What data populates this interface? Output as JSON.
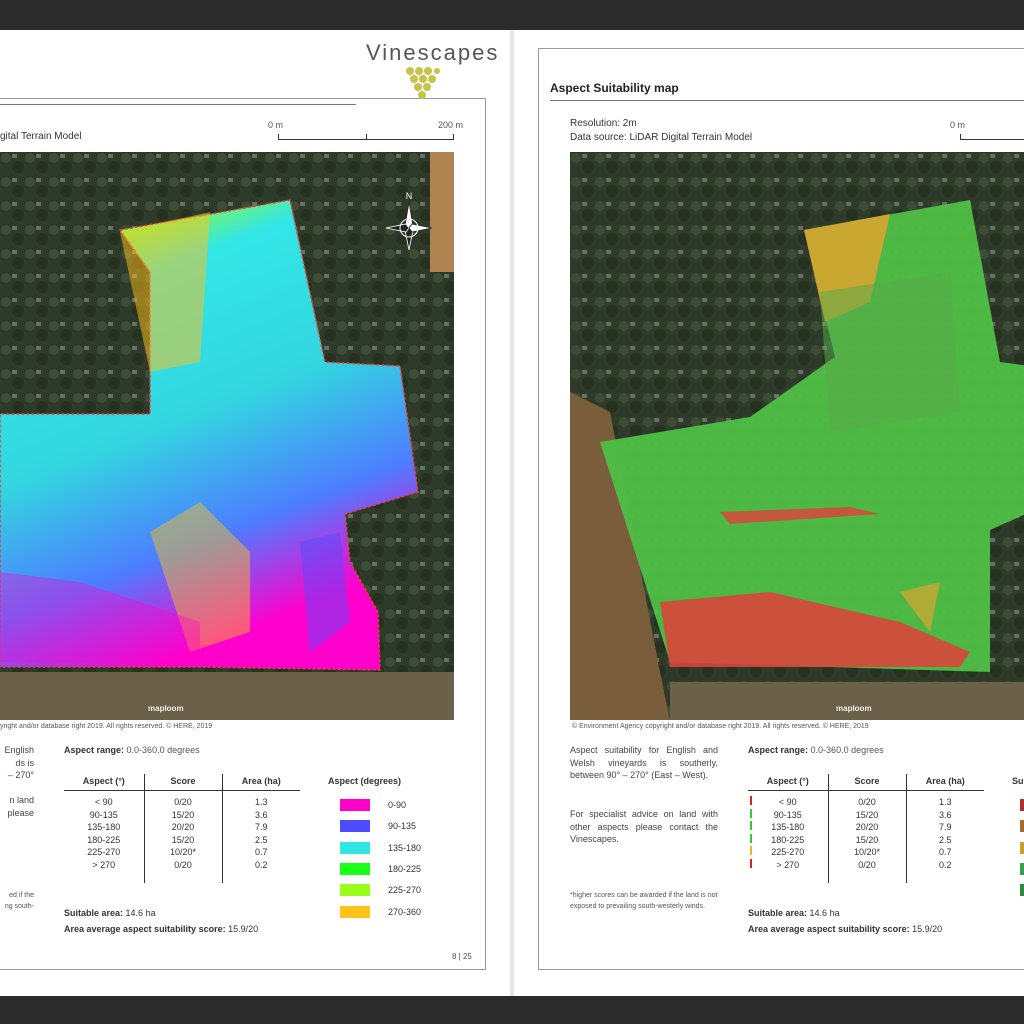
{
  "left_page": {
    "logo": "Vinescapes",
    "data_source_partial": "gital Terrain Model",
    "scale": {
      "start": "0 m",
      "end": "200 m"
    },
    "north_label": "N",
    "map_watermark": "maploom",
    "copyright_partial": "yright and/or database right 2019. All rights reserved. © HERE, 2019",
    "side_text": [
      "English",
      "ds is",
      "– 270°",
      "",
      "n land",
      "please"
    ],
    "footnote_partial": [
      "ed if the",
      "ng south-"
    ],
    "aspect_range_label": "Aspect range:",
    "aspect_range_value": "0.0-360.0 degrees",
    "table": {
      "headers": [
        "Aspect (°)",
        "Score",
        "Area (ha)"
      ],
      "rows": [
        [
          "< 90",
          "0/20",
          "1.3"
        ],
        [
          "90-135",
          "15/20",
          "3.6"
        ],
        [
          "135-180",
          "20/20",
          "7.9"
        ],
        [
          "180-225",
          "15/20",
          "2.5"
        ],
        [
          "225-270",
          "10/20*",
          "0.7"
        ],
        [
          "> 270",
          "0/20",
          "0.2"
        ]
      ]
    },
    "legend_title": "Aspect (degrees)",
    "legend": [
      {
        "label": "0-90",
        "color": "#ff00cc"
      },
      {
        "label": "90-135",
        "color": "#4d4dff"
      },
      {
        "label": "135-180",
        "color": "#33e6e6"
      },
      {
        "label": "180-225",
        "color": "#1aff1a"
      },
      {
        "label": "225-270",
        "color": "#99ff1a"
      },
      {
        "label": "270-360",
        "color": "#ffc21a"
      }
    ],
    "suitable_area_label": "Suitable area:",
    "suitable_area_value": "14.6 ha",
    "avg_label": "Area average aspect suitability score:",
    "avg_value": "15.9/20",
    "page_number": "8 | 25"
  },
  "right_page": {
    "title": "Aspect Suitability map",
    "resolution": "Resolution: 2m",
    "data_source": "Data source: LiDAR Digital Terrain Model",
    "scale_start": "0 m",
    "map_watermark": "maploom",
    "copyright": "© Environment Agency copyright and/or database right 2019. All rights reserved. © HERE, 2019",
    "para1": "Aspect suitability for English and Welsh vineyards is southerly, between 90° – 270° (East – West).",
    "para2": "For specialist advice on land with other aspects please contact the Vinescapes.",
    "footnote": "*higher scores can be awarded if the land is not exposed to prevailing south-westerly winds.",
    "aspect_range_label": "Aspect range:",
    "aspect_range_value": "0.0-360.0 degrees",
    "table": {
      "headers": [
        "Aspect (°)",
        "Score",
        "Area (ha)"
      ],
      "rows": [
        [
          "< 90",
          "0/20",
          "1.3"
        ],
        [
          "90-135",
          "15/20",
          "3.6"
        ],
        [
          "135-180",
          "20/20",
          "7.9"
        ],
        [
          "180-225",
          "15/20",
          "2.5"
        ],
        [
          "225-270",
          "10/20*",
          "0.7"
        ],
        [
          "> 270",
          "0/20",
          "0.2"
        ]
      ],
      "flag_colors": [
        "#e02020",
        "#33cc33",
        "#33cc33",
        "#33cc33",
        "#f0b020",
        "#e02020"
      ]
    },
    "legend_title_partial": "Su",
    "legend_swatches": [
      "#b03030",
      "#a06a30",
      "#c8a030",
      "#3aa050",
      "#2a8a40"
    ],
    "suitable_area_label": "Suitable area:",
    "suitable_area_value": "14.6 ha",
    "avg_label": "Area average aspect suitability score:",
    "avg_value": "15.9/20"
  }
}
